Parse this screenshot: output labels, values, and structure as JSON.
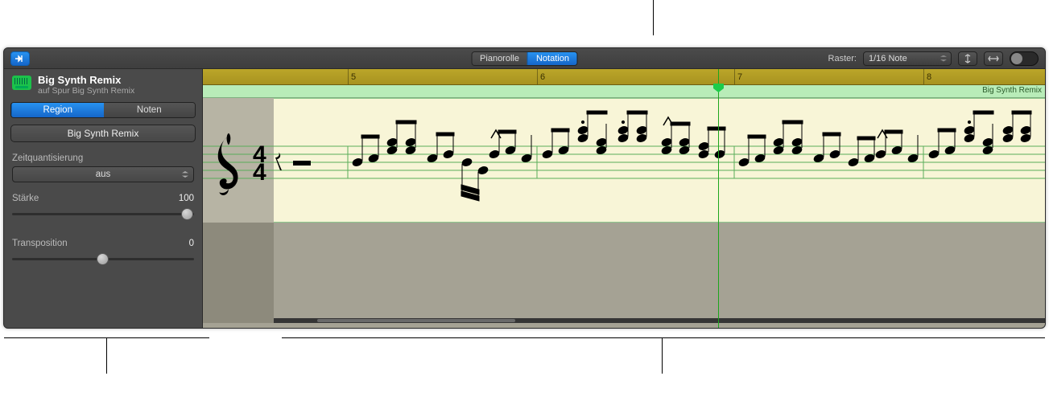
{
  "toolbar": {
    "view_tab_pianoroll": "Pianorolle",
    "view_tab_notation": "Notation",
    "raster_label": "Raster:",
    "raster_value": "1/16 Note"
  },
  "inspector": {
    "track_title": "Big Synth Remix",
    "track_subtitle": "auf Spur Big Synth Remix",
    "tab_region": "Region",
    "tab_noten": "Noten",
    "region_name": "Big Synth Remix",
    "quantize_label": "Zeitquantisierung",
    "quantize_value": "aus",
    "strength_label": "Stärke",
    "strength_value": "100",
    "transpose_label": "Transposition",
    "transpose_value": "0"
  },
  "ruler": {
    "marks": [
      "5",
      "6",
      "7",
      "8"
    ]
  },
  "region_strip_label": "Big Synth Remix",
  "time_signature": {
    "num": "4",
    "den": "4"
  }
}
